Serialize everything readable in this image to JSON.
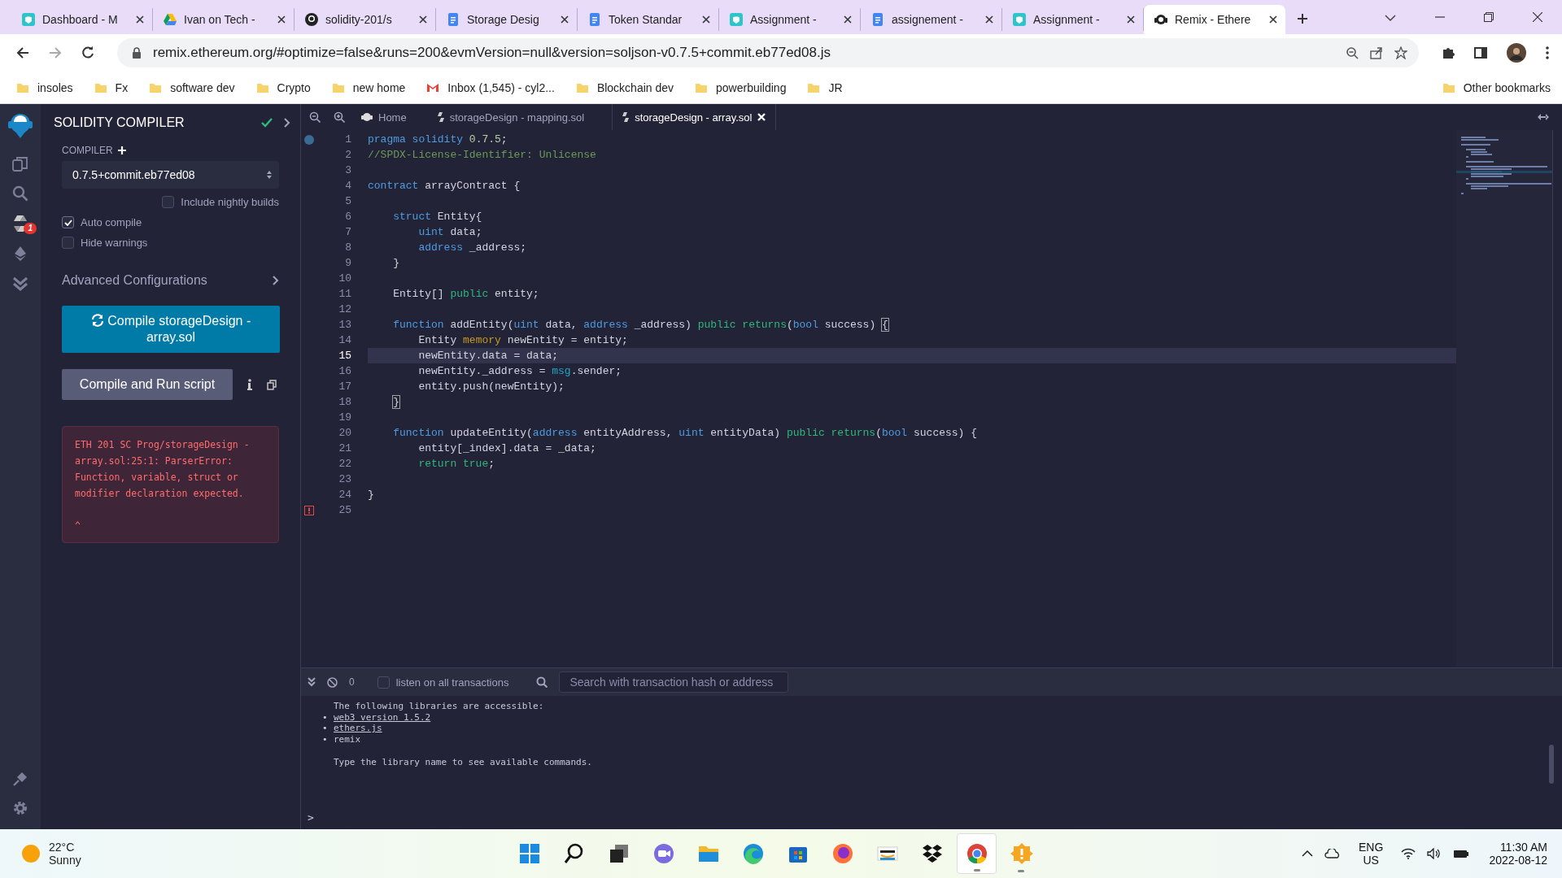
{
  "browser": {
    "tabs": [
      {
        "title": "Dashboard - M",
        "kind": "teal",
        "selected": false
      },
      {
        "title": "Ivan on Tech -",
        "kind": "drive",
        "selected": false
      },
      {
        "title": "solidity-201/s",
        "kind": "github",
        "selected": false
      },
      {
        "title": "Storage Desig",
        "kind": "doc",
        "selected": false
      },
      {
        "title": "Token Standar",
        "kind": "doc",
        "selected": false
      },
      {
        "title": "Assignment -",
        "kind": "teal",
        "selected": false
      },
      {
        "title": "assignement -",
        "kind": "doc",
        "selected": false
      },
      {
        "title": "Assignment -",
        "kind": "teal",
        "selected": false
      },
      {
        "title": "Remix - Ethere",
        "kind": "remix",
        "selected": true
      }
    ],
    "url": "remix.ethereum.org/#optimize=false&runs=200&evmVersion=null&version=soljson-v0.7.5+commit.eb77ed08.js",
    "bookmarks": [
      {
        "label": "insoles",
        "kind": "folder"
      },
      {
        "label": "Fx",
        "kind": "folder"
      },
      {
        "label": "software dev",
        "kind": "folder"
      },
      {
        "label": "Crypto",
        "kind": "folder"
      },
      {
        "label": "new home",
        "kind": "folder"
      },
      {
        "label": "Inbox (1,545) - cyl2...",
        "kind": "mail"
      },
      {
        "label": "Blockchain dev",
        "kind": "folder"
      },
      {
        "label": "powerbuilding",
        "kind": "folder"
      },
      {
        "label": "JR",
        "kind": "folder"
      }
    ],
    "other_bookmarks": "Other bookmarks"
  },
  "remix": {
    "badge": "1",
    "panel_title": "SOLIDITY COMPILER",
    "compiler_label": "COMPILER",
    "compiler_version": "0.7.5+commit.eb77ed08",
    "options": [
      {
        "label": "Include nightly builds",
        "checked": false
      },
      {
        "label": "Auto compile",
        "checked": true
      },
      {
        "label": "Hide warnings",
        "checked": false
      }
    ],
    "advanced": "Advanced Configurations",
    "compile_button": "Compile storageDesign - array.sol",
    "run_button": "Compile and Run script",
    "error": {
      "message": "ETH 201 SC Prog/storageDesign - array.sol:25:1: ParserError: Function, variable, struct or modifier declaration expected.",
      "caret": "^"
    }
  },
  "editor": {
    "tabs": [
      {
        "label": "Home",
        "kind": "home",
        "selected": false
      },
      {
        "label": "storageDesign - mapping.sol",
        "kind": "file",
        "selected": false
      },
      {
        "label": "storageDesign - array.sol",
        "kind": "file",
        "selected": true
      }
    ],
    "lines": [
      {
        "n": "1",
        "kind": "info",
        "current": false,
        "tokens": [
          {
            "text": "pragma",
            "kind": "kw"
          },
          {
            "text": " solidity",
            "kind": "kw"
          },
          {
            "text": " 0.7.5",
            "kind": "num"
          },
          {
            "text": ";",
            "kind": "p"
          }
        ]
      },
      {
        "n": "2",
        "kind": "plain",
        "current": false,
        "tokens": [
          {
            "text": "//SPDX-License-Identifier: Unlicense",
            "kind": "com"
          }
        ]
      },
      {
        "n": "3",
        "kind": "plain",
        "current": false
      },
      {
        "n": "4",
        "kind": "plain",
        "current": false,
        "tokens": [
          {
            "text": "contract",
            "kind": "kw"
          },
          {
            "text": " arrayContract {",
            "kind": "p"
          }
        ]
      },
      {
        "n": "5",
        "kind": "plain",
        "current": false
      },
      {
        "n": "6",
        "kind": "plain",
        "current": false,
        "tokens": [
          {
            "text": "    struct",
            "kind": "kw"
          },
          {
            "text": " Entity{",
            "kind": "p"
          }
        ]
      },
      {
        "n": "7",
        "kind": "plain",
        "current": false,
        "tokens": [
          {
            "text": "        uint",
            "kind": "kw"
          },
          {
            "text": " data;",
            "kind": "p"
          }
        ]
      },
      {
        "n": "8",
        "kind": "plain",
        "current": false,
        "tokens": [
          {
            "text": "        address",
            "kind": "kw"
          },
          {
            "text": " _address;",
            "kind": "p"
          }
        ]
      },
      {
        "n": "9",
        "kind": "plain",
        "current": false,
        "tokens": [
          {
            "text": "    }",
            "kind": "p"
          }
        ]
      },
      {
        "n": "10",
        "kind": "plain",
        "current": false
      },
      {
        "n": "11",
        "kind": "plain",
        "current": false,
        "tokens": [
          {
            "text": "    Entity[] ",
            "kind": "p"
          },
          {
            "text": "public",
            "kind": "grn"
          },
          {
            "text": " entity;",
            "kind": "p"
          }
        ]
      },
      {
        "n": "12",
        "kind": "plain",
        "current": false
      },
      {
        "n": "13",
        "kind": "plain",
        "current": false,
        "tokens": [
          {
            "text": "    function",
            "kind": "kw"
          },
          {
            "text": " addEntity(",
            "kind": "p"
          },
          {
            "text": "uint",
            "kind": "kw"
          },
          {
            "text": " data, ",
            "kind": "p"
          },
          {
            "text": "address",
            "kind": "kw"
          },
          {
            "text": " _address) ",
            "kind": "p"
          },
          {
            "text": "public",
            "kind": "grn"
          },
          {
            "text": " returns",
            "kind": "grn"
          },
          {
            "text": "(",
            "kind": "p"
          },
          {
            "text": "bool",
            "kind": "kw"
          },
          {
            "text": " success) ",
            "kind": "p"
          },
          {
            "text": "{",
            "kind": "match"
          }
        ]
      },
      {
        "n": "14",
        "kind": "plain",
        "current": false,
        "tokens": [
          {
            "text": "        Entity ",
            "kind": "p"
          },
          {
            "text": "memory",
            "kind": "mem"
          },
          {
            "text": " newEntity = entity;",
            "kind": "p"
          }
        ]
      },
      {
        "n": "15",
        "kind": "plain",
        "current": true,
        "tokens": [
          {
            "text": "        newEntity.data = data;",
            "kind": "p"
          }
        ]
      },
      {
        "n": "16",
        "kind": "plain",
        "current": false,
        "tokens": [
          {
            "text": "        newEntity._address = ",
            "kind": "p"
          },
          {
            "text": "msg",
            "kind": "bi"
          },
          {
            "text": ".sender;",
            "kind": "p"
          }
        ]
      },
      {
        "n": "17",
        "kind": "plain",
        "current": false,
        "tokens": [
          {
            "text": "        entity.push(newEntity);",
            "kind": "p"
          }
        ]
      },
      {
        "n": "18",
        "kind": "plain",
        "current": false,
        "tokens": [
          {
            "text": "    }",
            "kind": "match"
          }
        ]
      },
      {
        "n": "19",
        "kind": "plain",
        "current": false
      },
      {
        "n": "20",
        "kind": "plain",
        "current": false,
        "tokens": [
          {
            "text": "    function",
            "kind": "kw"
          },
          {
            "text": " updateEntity(",
            "kind": "p"
          },
          {
            "text": "address",
            "kind": "kw"
          },
          {
            "text": " entityAddress, ",
            "kind": "p"
          },
          {
            "text": "uint",
            "kind": "kw"
          },
          {
            "text": " entityData) ",
            "kind": "p"
          },
          {
            "text": "public",
            "kind": "grn"
          },
          {
            "text": " returns",
            "kind": "grn"
          },
          {
            "text": "(",
            "kind": "p"
          },
          {
            "text": "bool",
            "kind": "kw"
          },
          {
            "text": " success) {",
            "kind": "p"
          }
        ]
      },
      {
        "n": "21",
        "kind": "plain",
        "current": false,
        "tokens": [
          {
            "text": "        entity[_index].data = _data;",
            "kind": "p"
          }
        ]
      },
      {
        "n": "22",
        "kind": "plain",
        "current": false,
        "tokens": [
          {
            "text": "        return",
            "kind": "grn"
          },
          {
            "text": " true",
            "kind": "grn"
          },
          {
            "text": ";",
            "kind": "p"
          }
        ]
      },
      {
        "n": "23",
        "kind": "plain",
        "current": false
      },
      {
        "n": "24",
        "kind": "plain",
        "current": false,
        "tokens": [
          {
            "text": "}",
            "kind": "p"
          }
        ]
      },
      {
        "n": "25",
        "kind": "error",
        "current": false
      }
    ]
  },
  "terminal": {
    "pending": "0",
    "listen": {
      "label": "listen on all transactions",
      "checked": false
    },
    "search": {
      "placeholder": "Search with transaction hash or address"
    },
    "intro": "The following libraries are accessible:",
    "libraries": [
      {
        "bullet": "•",
        "text": "web3 version 1.5.2",
        "link": true
      },
      {
        "bullet": "•",
        "text": "ethers.js",
        "link": true
      },
      {
        "bullet": "•",
        "text": "remix",
        "link": false
      }
    ],
    "hint": "Type the library name to see available commands.",
    "prompt": ">"
  },
  "taskbar": {
    "weather": {
      "temp": "22°C",
      "condition": "Sunny"
    },
    "apps": [
      {
        "kind": "start",
        "selected": false,
        "running": false
      },
      {
        "kind": "search",
        "selected": false,
        "running": false
      },
      {
        "kind": "taskview",
        "selected": false,
        "running": false
      },
      {
        "kind": "chat",
        "selected": false,
        "running": false
      },
      {
        "kind": "files",
        "selected": false,
        "running": false
      },
      {
        "kind": "edge",
        "selected": false,
        "running": false
      },
      {
        "kind": "store",
        "selected": false,
        "running": false
      },
      {
        "kind": "firefox",
        "selected": false,
        "running": false
      },
      {
        "kind": "amazon",
        "selected": false,
        "running": false
      },
      {
        "kind": "dropbox",
        "selected": false,
        "running": false
      },
      {
        "kind": "chrome",
        "selected": true,
        "running": true
      },
      {
        "kind": "badge",
        "selected": false,
        "running": true
      }
    ],
    "language": "ENG",
    "region": "US",
    "time": "11:30 AM",
    "date": "2022-08-12"
  }
}
